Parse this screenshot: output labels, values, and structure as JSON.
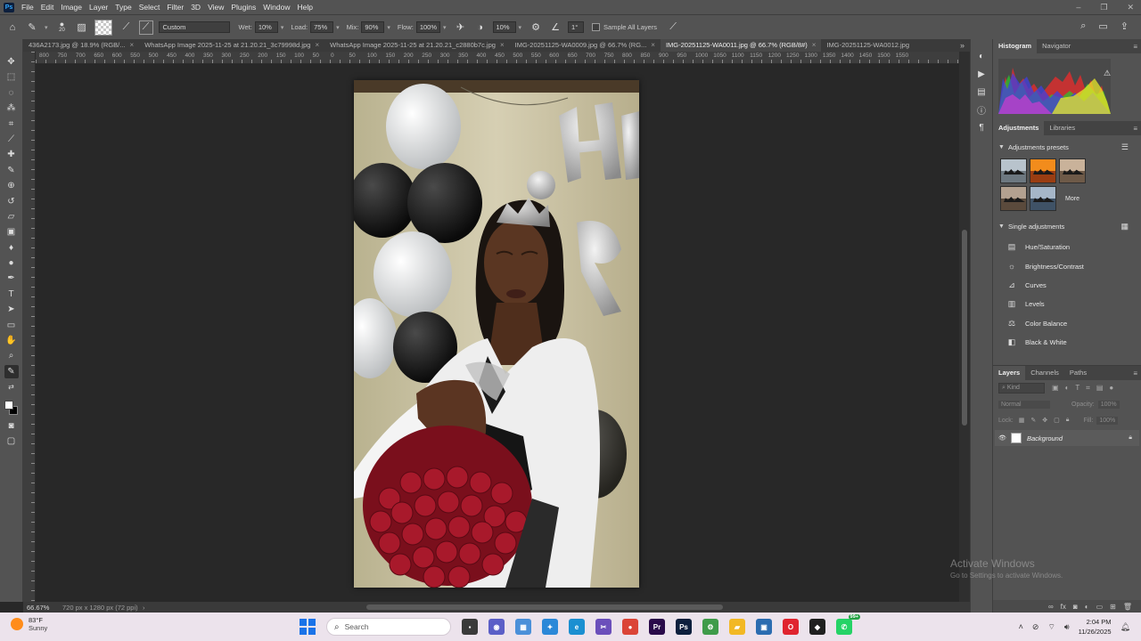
{
  "app": {
    "logo": "Ps"
  },
  "menu": [
    "File",
    "Edit",
    "Image",
    "Layer",
    "Type",
    "Select",
    "Filter",
    "3D",
    "View",
    "Plugins",
    "Window",
    "Help"
  ],
  "window_controls": {
    "minimize": "–",
    "restore": "❐",
    "close": "✕"
  },
  "options": {
    "brush_size": "20",
    "preset": "Custom",
    "wet_label": "Wet:",
    "wet_value": "10%",
    "load_label": "Load:",
    "load_value": "75%",
    "mix_label": "Mix:",
    "mix_value": "90%",
    "flow_label": "Flow:",
    "flow_value": "100%",
    "smoothing_value": "10%",
    "angle_value": "1°",
    "sample_all_layers": "Sample All Layers"
  },
  "tabs": [
    {
      "label": "436A2173.jpg @ 18.9% (RGB/...",
      "active": false
    },
    {
      "label": "WhatsApp Image 2025-11-25 at 21.20.21_3c79998d.jpg",
      "active": false
    },
    {
      "label": "WhatsApp Image 2025-11-25 at 21.20.21_c2880b7c.jpg",
      "active": false
    },
    {
      "label": "IMG-20251125-WA0009.jpg @ 66.7% (RG...",
      "active": false
    },
    {
      "label": "IMG-20251125-WA0011.jpg @ 66.7% (RGB/8#)",
      "active": true
    },
    {
      "label": "IMG-20251125-WA0012.jpg",
      "active": false
    }
  ],
  "ruler_top": [
    "800",
    "750",
    "700",
    "650",
    "600",
    "550",
    "500",
    "450",
    "400",
    "350",
    "300",
    "250",
    "200",
    "150",
    "100",
    "50",
    "0",
    "50",
    "100",
    "150",
    "200",
    "250",
    "300",
    "350",
    "400",
    "450",
    "500",
    "550",
    "600",
    "650",
    "700",
    "750",
    "800",
    "850",
    "900",
    "950",
    "1000",
    "1050",
    "1100",
    "1150",
    "1200",
    "1250",
    "1300",
    "1350",
    "1400",
    "1450",
    "1500",
    "1550"
  ],
  "status": {
    "zoom": "66.67%",
    "doc_info": "720 px x 1280 px (72 ppi)"
  },
  "panels": {
    "histogram_tabs": [
      "Histogram",
      "Navigator"
    ],
    "adjustments_tabs": [
      "Adjustments",
      "Libraries"
    ],
    "presets_title": "Adjustments presets",
    "presets": [
      {
        "sky": "#b8c3cc",
        "ground": "#6d7880"
      },
      {
        "sky": "#f28c1c",
        "ground": "#9a3d12"
      },
      {
        "sky": "#c9b29a",
        "ground": "#6e5a48"
      },
      {
        "sky": "#b3a190",
        "ground": "#5a4a3c"
      },
      {
        "sky": "#a5b6c8",
        "ground": "#3f5266"
      }
    ],
    "presets_more": "More",
    "single_title": "Single adjustments",
    "single_adjustments": [
      {
        "label": "Hue/Saturation",
        "icon": "▤"
      },
      {
        "label": "Brightness/Contrast",
        "icon": "☼"
      },
      {
        "label": "Curves",
        "icon": "⊿"
      },
      {
        "label": "Levels",
        "icon": "▥"
      },
      {
        "label": "Color Balance",
        "icon": "⚖"
      },
      {
        "label": "Black & White",
        "icon": "◧"
      }
    ],
    "layers_tabs": [
      "Layers",
      "Channels",
      "Paths"
    ],
    "layers_filter": "Kind",
    "blend_mode": "Normal",
    "opacity_label": "Opacity:",
    "opacity_value": "100%",
    "lock_label": "Lock:",
    "fill_label": "Fill:",
    "fill_value": "100%",
    "layer_name": "Background"
  },
  "watermark": {
    "title": "Activate Windows",
    "subtitle": "Go to Settings to activate Windows."
  },
  "taskbar": {
    "weather_temp": "83°F",
    "weather_condition": "Sunny",
    "search_placeholder": "Search",
    "time": "2:04 PM",
    "date": "11/26/2025",
    "badge": "99+",
    "apps": [
      {
        "name": "file-explorer-icon",
        "color": "#3a3a3a",
        "glyph": "▪"
      },
      {
        "name": "chat-icon",
        "color": "#5b5fc7",
        "glyph": "◉"
      },
      {
        "name": "photos-icon",
        "color": "#4a90d9",
        "glyph": "▦"
      },
      {
        "name": "copilot-icon",
        "color": "#2b88d8",
        "glyph": "✦"
      },
      {
        "name": "edge-icon",
        "color": "#1b8fd1",
        "glyph": "e"
      },
      {
        "name": "snipping-icon",
        "color": "#6b4fbb",
        "glyph": "✂"
      },
      {
        "name": "chrome-icon",
        "color": "#db4437",
        "glyph": "●"
      },
      {
        "name": "premiere-icon",
        "color": "#2a0a4a",
        "glyph": "Pr"
      },
      {
        "name": "photoshop-icon",
        "color": "#0d1f3d",
        "glyph": "Ps"
      },
      {
        "name": "green-app-icon",
        "color": "#3f9b4a",
        "glyph": "⚙"
      },
      {
        "name": "folder-icon",
        "color": "#f2b824",
        "glyph": "▰"
      },
      {
        "name": "store-icon",
        "color": "#2b6cb0",
        "glyph": "▣"
      },
      {
        "name": "opera-icon",
        "color": "#e0242f",
        "glyph": "O"
      },
      {
        "name": "app-dark-icon",
        "color": "#202020",
        "glyph": "◆"
      },
      {
        "name": "whatsapp-icon",
        "color": "#25d366",
        "glyph": "✆"
      }
    ]
  },
  "colors": {
    "foreground": "#ffffff",
    "background": "#000000",
    "accent": "#31a8ff"
  }
}
